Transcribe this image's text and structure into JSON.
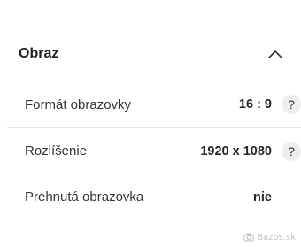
{
  "section": {
    "title": "Obraz",
    "toggle_icon": "chevron-up-icon"
  },
  "specs": [
    {
      "label": "Formát obrazovky",
      "value": "16 : 9",
      "help": "?"
    },
    {
      "label": "Rozlíšenie",
      "value": "1920 x 1080",
      "help": "?"
    },
    {
      "label": "Prehnutá obrazovka",
      "value": "nie"
    }
  ],
  "watermark": {
    "text": "Bazos.sk",
    "icon": "camera-icon"
  }
}
